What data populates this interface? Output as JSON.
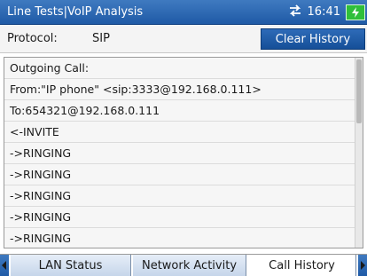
{
  "titlebar": {
    "title": "Line Tests|VoIP Analysis",
    "time": "16:41",
    "network_icon": "network-transfer-icon",
    "battery_icon": "battery-charging-icon"
  },
  "protocol": {
    "label": "Protocol:",
    "value": "SIP",
    "clear_button": "Clear History"
  },
  "log": {
    "lines": [
      "Outgoing Call:",
      "From:\"IP phone\" <sip:3333@192.168.0.111>",
      "To:654321@192.168.0.111",
      "<-INVITE",
      "->RINGING",
      "->RINGING",
      "->RINGING",
      "->RINGING",
      "->RINGING"
    ]
  },
  "tabs": {
    "items": [
      {
        "label": "LAN Status",
        "active": false
      },
      {
        "label": "Network Activity",
        "active": false
      },
      {
        "label": "Call History",
        "active": true
      }
    ]
  },
  "colors": {
    "titlebar": "#1f5aa6",
    "button": "#154f98",
    "battery": "#2fbf3a"
  }
}
